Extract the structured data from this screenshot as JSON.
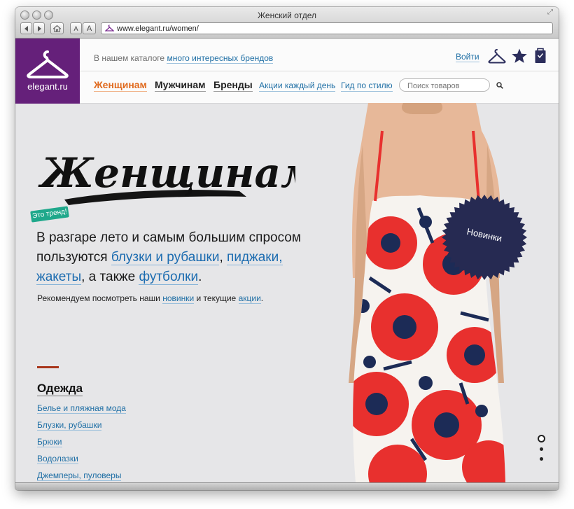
{
  "window": {
    "title": "Женский отдел",
    "url": "www.elegant.ru/women/"
  },
  "toolbar": {
    "back_icon": "back-arrow-icon",
    "forward_icon": "forward-arrow-icon",
    "home_icon": "home-icon",
    "font_small": "A",
    "font_large": "A"
  },
  "header": {
    "logo_text": "elegant.ru",
    "catalog_prefix": "В нашем каталоге",
    "catalog_link": "много интересных брендов",
    "login": "Войти",
    "icons": [
      "hanger-icon",
      "star-icon",
      "bag-icon"
    ]
  },
  "nav": {
    "women": "Женщинам",
    "men": "Мужчинам",
    "brands": "Бренды",
    "promo": "Акции каждый день",
    "style_guide": "Гид по стилю",
    "search_placeholder": "Поиск товаров"
  },
  "hero": {
    "title": "Женщинам",
    "trend_badge": "Это тренд!",
    "lead_1": "В разгаре лето и самым большим спросом пользуются ",
    "lead_link_1": "блузки и рубашки",
    "lead_2": ", ",
    "lead_link_2": "пиджаки, жакеты",
    "lead_3": ", а также ",
    "lead_link_3": "футболки",
    "lead_4": ".",
    "recommend_1": "Рекомендуем посмотреть наши ",
    "recommend_link_1": "новинки",
    "recommend_2": " и текущие ",
    "recommend_link_2": "акции",
    "recommend_3": ".",
    "new_badge": "Новинки"
  },
  "category": {
    "title": "Одежда",
    "links": [
      "Белье и пляжная мода",
      "Блузки, рубашки",
      "Брюки",
      "Водолазки",
      "Джемперы, пуловеры"
    ]
  },
  "slider": {
    "count": 3,
    "active": 1
  },
  "colors": {
    "brand_purple": "#65207a",
    "accent_orange": "#e06a1e",
    "link_blue": "#1f6fa5",
    "badge_navy": "#262a52",
    "trend_green": "#1fa88b"
  }
}
